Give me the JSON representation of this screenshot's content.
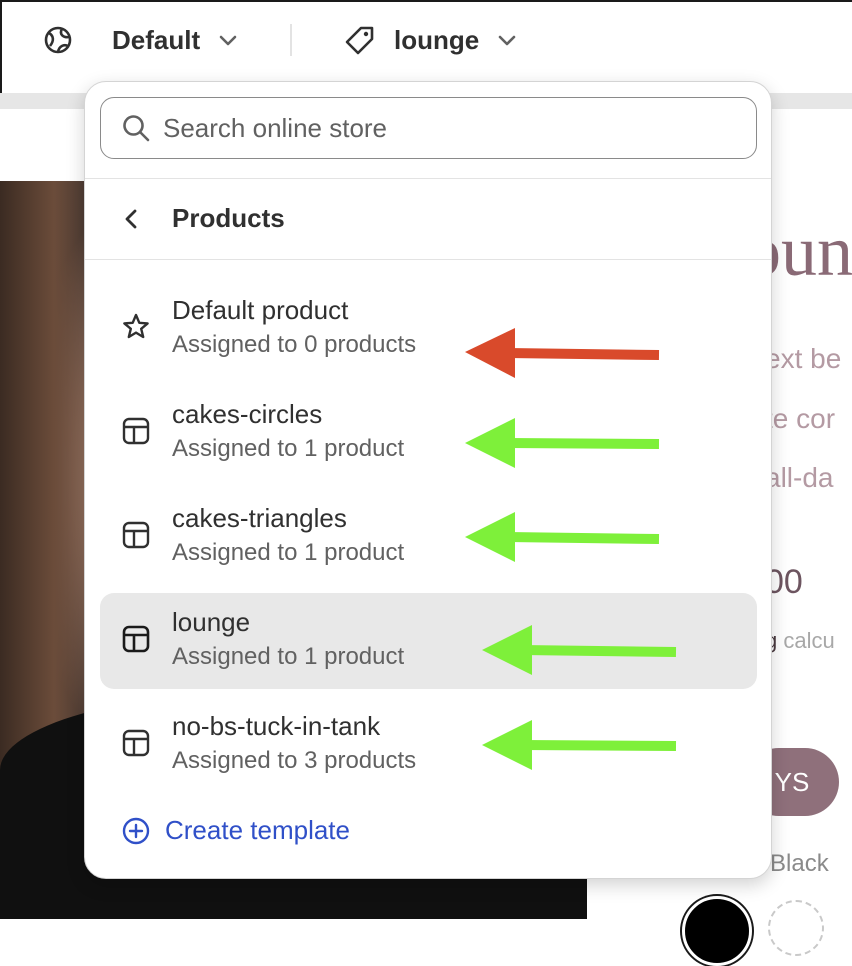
{
  "topbar": {
    "theme_label": "Default",
    "template_label": "lounge",
    "icons": {
      "theme": "globe-icon",
      "template": "tag-icon",
      "chevron": "chevron-down-icon"
    }
  },
  "panel": {
    "search_placeholder": "Search online store",
    "back_title": "Products",
    "items": [
      {
        "name": "Default product",
        "subtitle": "Assigned to 0 products",
        "icon": "star-icon",
        "selected": false
      },
      {
        "name": "cakes-circles",
        "subtitle": "Assigned to 1 product",
        "icon": "template-layout-icon",
        "selected": false
      },
      {
        "name": "cakes-triangles",
        "subtitle": "Assigned to 1 product",
        "icon": "template-layout-icon",
        "selected": false
      },
      {
        "name": "lounge",
        "subtitle": "Assigned to 1 product",
        "icon": "template-layout-icon",
        "selected": true
      },
      {
        "name": "no-bs-tuck-in-tank",
        "subtitle": "Assigned to 3 products",
        "icon": "template-layout-icon",
        "selected": false
      }
    ],
    "create_label": "Create template"
  },
  "preview": {
    "title_fragment": "oun",
    "lines": [
      "ext be",
      "te cor",
      "all-da"
    ],
    "price_fragment": "00",
    "link_fragment": "g",
    "link_suffix": "calcu",
    "button_fragment": "YS",
    "color_label": "Black"
  },
  "annotations": {
    "red_arrow_color": "#d94a2b",
    "green_arrow_color": "#7ef03a"
  }
}
